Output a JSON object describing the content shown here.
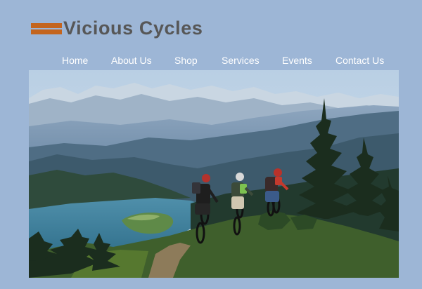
{
  "site": {
    "name": "Vicious Cycles",
    "colors": {
      "background": "#9db6d6",
      "logo_accent": "#c4651e",
      "logo_text": "#575757",
      "nav_text": "#ffffff"
    }
  },
  "nav": {
    "items": [
      {
        "id": "home",
        "label": "Home"
      },
      {
        "id": "about",
        "label": "About Us"
      },
      {
        "id": "shop",
        "label": "Shop"
      },
      {
        "id": "services",
        "label": "Services"
      },
      {
        "id": "events",
        "label": "Events"
      },
      {
        "id": "contact",
        "label": "Contact Us"
      }
    ]
  },
  "hero": {
    "scene": "mountain-bikers-overlooking-lake"
  }
}
